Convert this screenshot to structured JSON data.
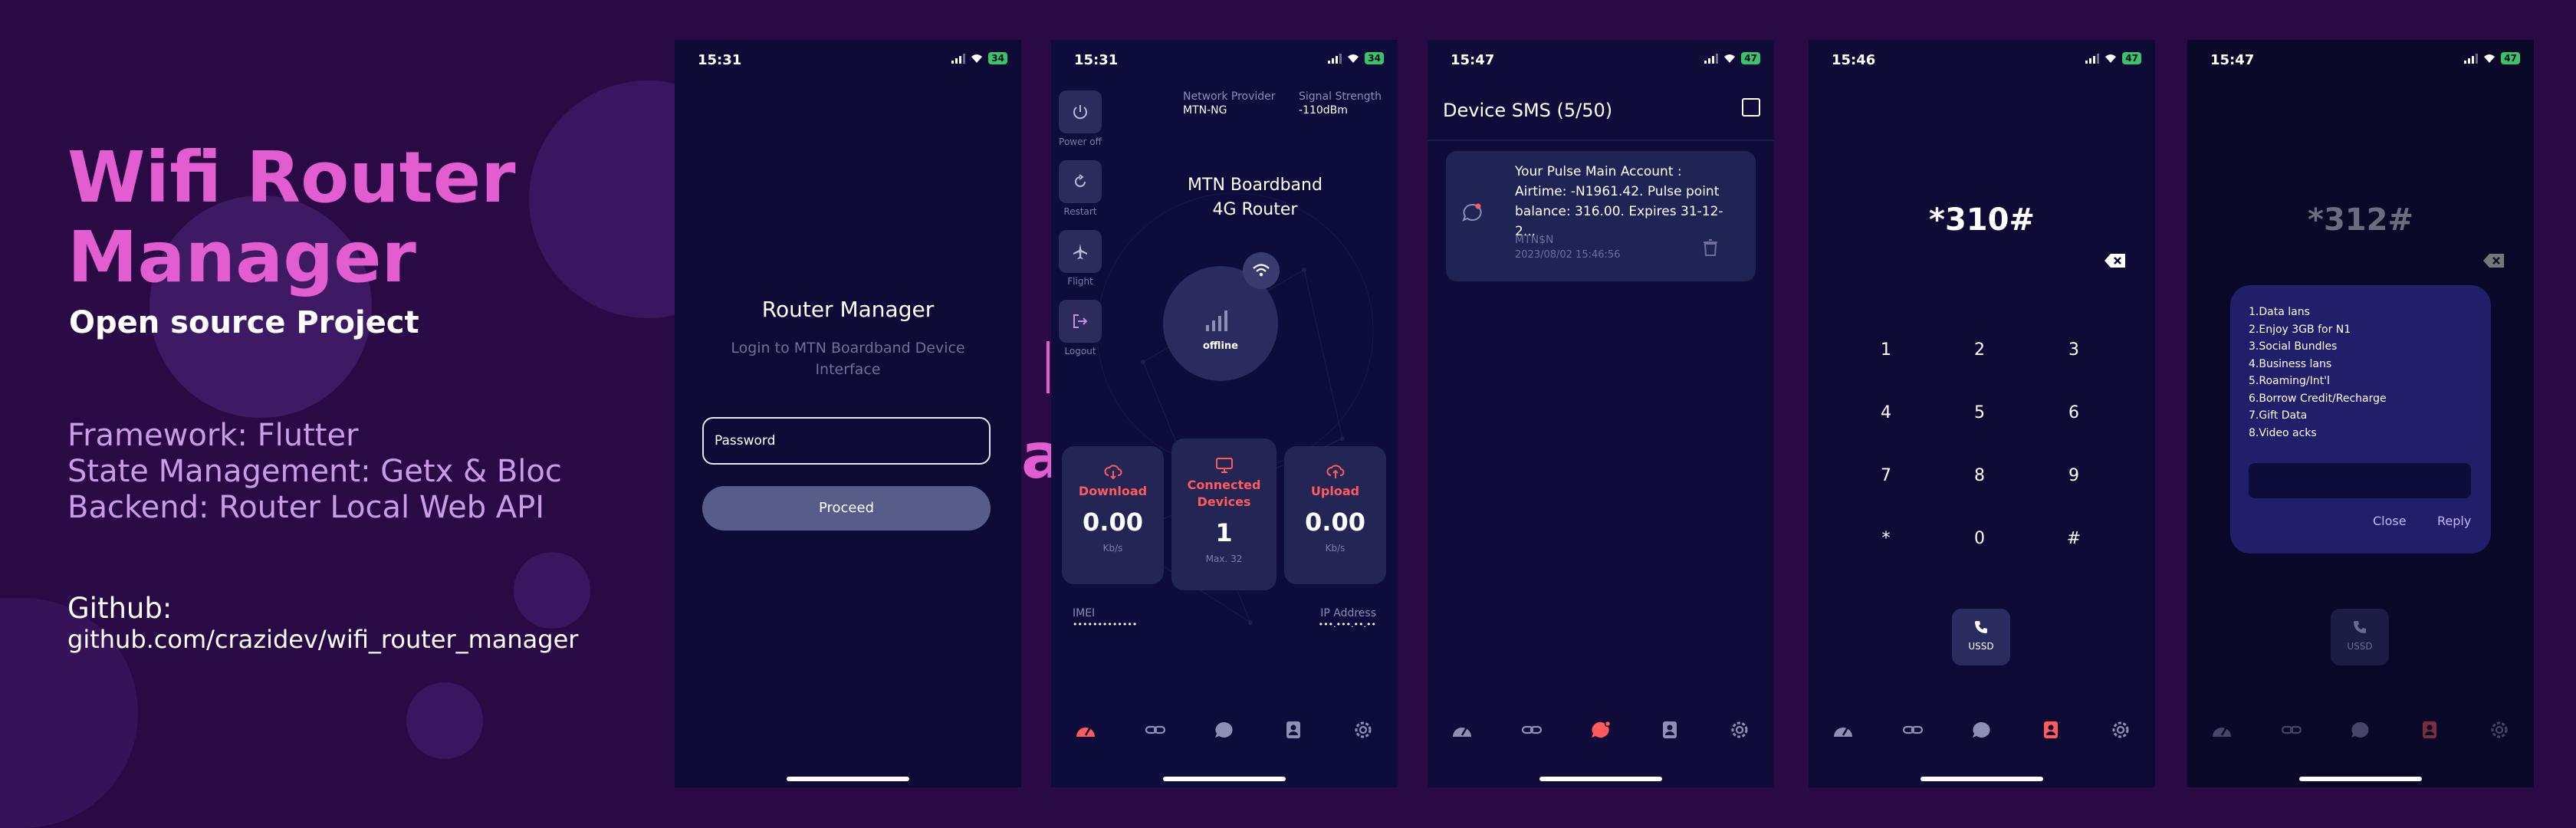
{
  "hero": {
    "title_line1": "Wifi Router",
    "title_line2": "Manager",
    "subtitle": "Open source Project",
    "framework": "Framework: Flutter",
    "state": "State Management: Getx & Bloc",
    "backend": "Backend: Router Local Web API",
    "github_label": "Github:",
    "github_url": "github.com/crazidev/wifi_router_manager"
  },
  "colors": {
    "bg": "#2a0a45",
    "accent": "#e15dd0",
    "phone": "#0d0a36",
    "danger": "#ff5b5b",
    "battery": "#39c46a"
  },
  "screen1": {
    "time": "15:31",
    "battery": "34",
    "title": "Router Manager",
    "subtitle": "Login to MTN Boardband Device Interface",
    "password_placeholder": "Password",
    "proceed": "Proceed"
  },
  "screen2": {
    "time": "15:31",
    "battery": "34",
    "provider_label": "Network Provider",
    "provider_value": "MTN-NG",
    "signal_label": "Signal Strength",
    "signal_value": "-110dBm",
    "router_line1": "MTN Boardband",
    "router_line2": "4G Router",
    "status": "offline",
    "controls": [
      "Power off",
      "Restart",
      "Flight",
      "Logout"
    ],
    "download_label": "Download",
    "download_value": "0.00",
    "download_unit": "Kb/s",
    "connected_line1": "Connected",
    "connected_line2": "Devices",
    "connected_value": "1",
    "connected_max": "Max. 32",
    "upload_label": "Upload",
    "upload_value": "0.00",
    "upload_unit": "Kb/s",
    "imei_label": "IMEI",
    "imei_value": "•••••••••••••",
    "ip_label": "IP Address",
    "ip_value": "•••.•••.••.••",
    "stray_letter": "a"
  },
  "screen3": {
    "time": "15:47",
    "battery": "47",
    "title": "Device SMS (5/50)",
    "sms_line1": "Your Pulse Main Account :",
    "sms_line2": "Airtime: -N1961.42. Pulse point",
    "sms_line3": "balance: 316.00. Expires 31-12-2...",
    "sms_sender": "MTN$N",
    "sms_date": "2023/08/02 15:46:56"
  },
  "screen4": {
    "time": "15:46",
    "battery": "47",
    "code": "*310#",
    "keys": [
      "1",
      "2",
      "3",
      "4",
      "5",
      "6",
      "7",
      "8",
      "9",
      "*",
      "0",
      "#"
    ],
    "ussd_label": "USSD"
  },
  "screen5": {
    "time": "15:47",
    "battery": "47",
    "code": "*312#",
    "menu": [
      "1.Data  lans",
      "2.Enjoy 3GB for N1",
      "3.Social Bundles",
      "4.Business  lans",
      "5.Roaming/Int'l",
      "6.Borrow Credit/Recharge",
      "7.Gift Data",
      "8.Video  acks"
    ],
    "close": "Close",
    "reply": "Reply",
    "ussd_label": "USSD"
  }
}
